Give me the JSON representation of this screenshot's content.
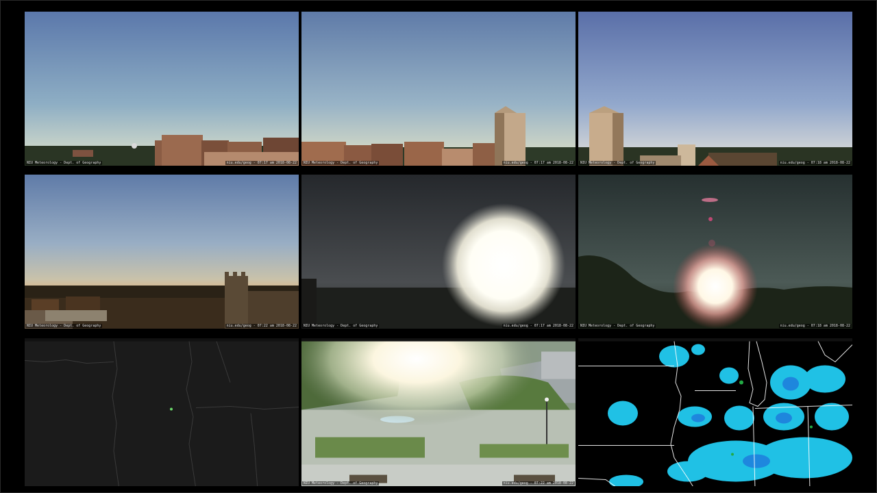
{
  "cameras": [
    {
      "caption_left": "NIU Meteorology - Dept. of Geography",
      "caption_right": "niu.edu/geog - 07:17 am 2018-08-22"
    },
    {
      "caption_left": "NIU Meteorology - Dept. of Geography",
      "caption_right": "niu.edu/geog - 07:17 am 2018-08-22"
    },
    {
      "caption_left": "NIU Meteorology - Dept. of Geography",
      "caption_right": "niu.edu/geog - 07:18 am 2018-08-22"
    },
    {
      "caption_left": "NIU Meteorology - Dept. of Geography",
      "caption_right": "niu.edu/geog - 07:22 am 2018-08-22"
    },
    {
      "caption_left": "NIU Meteorology - Dept. of Geography",
      "caption_right": "niu.edu/geog - 07:17 am 2018-08-22"
    },
    {
      "caption_left": "NIU Meteorology - Dept. of Geography",
      "caption_right": "niu.edu/geog - 07:18 am 2018-08-22"
    },
    {
      "caption_center": ""
    },
    {
      "caption_left": "NIU Meteorology - Dept. of Geography",
      "caption_right": "niu.edu/geog - 07:22 am 2018-08-22"
    },
    {
      "caption_center": ""
    }
  ],
  "colors": {
    "background": "#000000",
    "radar_cyan": "#22ccf2",
    "radar_blue": "#1e78dc",
    "radar_green": "#22aa44"
  }
}
